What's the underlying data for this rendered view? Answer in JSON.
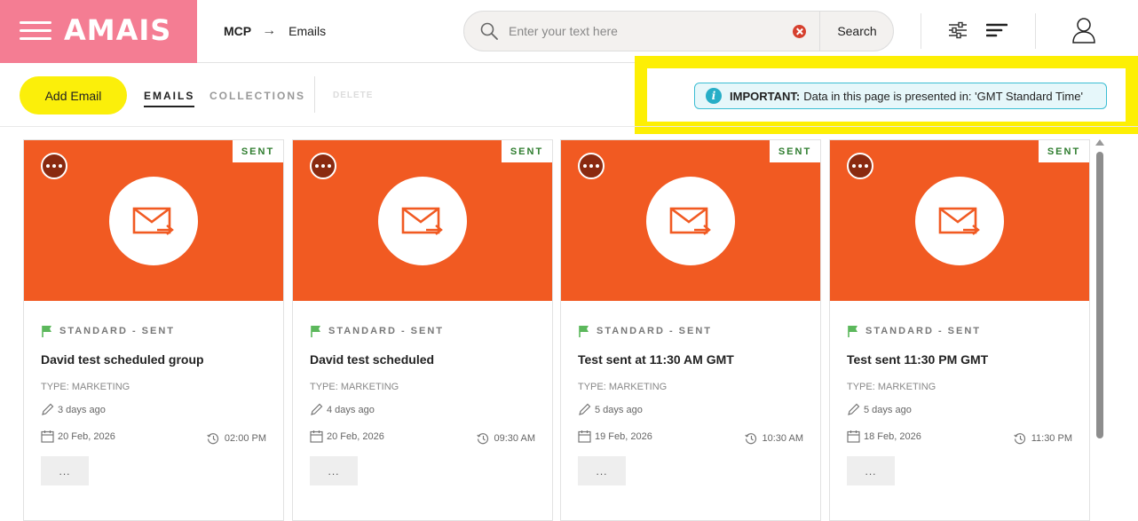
{
  "header": {
    "logo": "AMAIS",
    "breadcrumb": {
      "root": "MCP",
      "arrow": "→",
      "current": "Emails"
    },
    "search": {
      "placeholder": "Enter your text here",
      "value": "",
      "button_label": "Search"
    }
  },
  "toolbar": {
    "add_label": "Add Email",
    "tabs": [
      {
        "label": "EMAILS",
        "active": true
      },
      {
        "label": "COLLECTIONS",
        "active": false
      }
    ],
    "delete_label": "DELETE"
  },
  "notice": {
    "strong": "IMPORTANT:",
    "text": "Data in this page is presented in: 'GMT Standard Time'"
  },
  "cards": [
    {
      "badge": "SENT",
      "status": "STANDARD - SENT",
      "title": "David test scheduled group",
      "type": "TYPE: MARKETING",
      "edited": "3 days ago",
      "date": "20 Feb, 2026",
      "time": "02:00 PM",
      "more": "..."
    },
    {
      "badge": "SENT",
      "status": "STANDARD - SENT",
      "title": "David test scheduled",
      "type": "TYPE: MARKETING",
      "edited": "4 days ago",
      "date": "20 Feb, 2026",
      "time": "09:30 AM",
      "more": "..."
    },
    {
      "badge": "SENT",
      "status": "STANDARD - SENT",
      "title": "Test sent at 11:30 AM GMT",
      "type": "TYPE: MARKETING",
      "edited": "5 days ago",
      "date": "19 Feb, 2026",
      "time": "10:30 AM",
      "more": "..."
    },
    {
      "badge": "SENT",
      "status": "STANDARD - SENT",
      "title": "Test sent 11:30 PM GMT",
      "type": "TYPE: MARKETING",
      "edited": "5 days ago",
      "date": "18 Feb, 2026",
      "time": "11:30 PM",
      "more": "..."
    }
  ],
  "colors": {
    "brand": "#f47d93",
    "card_banner": "#f15a22",
    "add_button": "#fbef0a",
    "highlight": "#fdef04",
    "notice_border": "#3bbdd3",
    "flag": "#5cb85c"
  },
  "icons": [
    "hamburger-icon",
    "search-icon",
    "clear-icon",
    "filter-icon",
    "sort-icon",
    "user-icon",
    "info-icon",
    "menu-dots-icon",
    "mail-send-icon",
    "flag-icon",
    "edit-icon",
    "calendar-icon",
    "clock-icon"
  ]
}
